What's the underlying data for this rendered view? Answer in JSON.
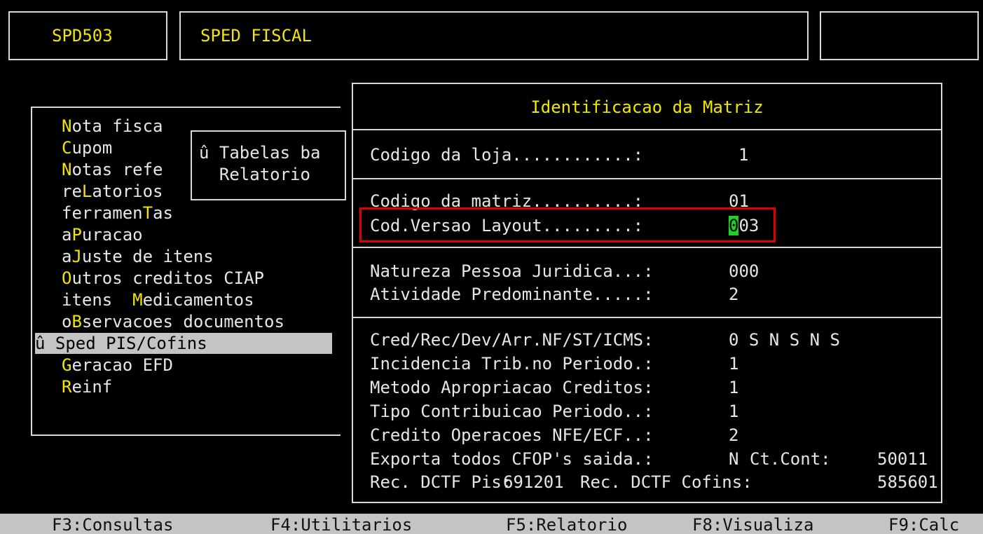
{
  "header": {
    "program_code": "SPD503",
    "title": "SPED FISCAL",
    "right_box": ""
  },
  "main_menu": {
    "items": [
      {
        "key": "N",
        "rest": "ota fisca"
      },
      {
        "key": "C",
        "rest": "upom"
      },
      {
        "key": "N",
        "rest": "otas refe"
      },
      {
        "pre": "re",
        "key": "L",
        "rest": "atorios"
      },
      {
        "pre": "ferramen",
        "key": "T",
        "rest": "as"
      },
      {
        "pre": "a",
        "key": "P",
        "rest": "uracao"
      },
      {
        "pre": "a",
        "key": "J",
        "rest": "uste de itens"
      },
      {
        "key": "O",
        "rest": "utros creditos CIAP"
      },
      {
        "pre": "itens  ",
        "key": "M",
        "rest": "edicamentos"
      },
      {
        "pre": "o",
        "key": "B",
        "rest": "servacoes documentos"
      },
      {
        "selected_label": "û Sped PIS/Cofins"
      },
      {
        "key": "G",
        "rest": "eracao EFD"
      },
      {
        "key": "R",
        "rest": "einf"
      }
    ]
  },
  "submenu": {
    "items": [
      "û Tabelas ba",
      "  Relatorio"
    ]
  },
  "panel": {
    "title": "Identificacao da Matriz",
    "codigo_loja_label": "Codigo da loja............:",
    "codigo_loja_value": "1",
    "codigo_matriz_label": "Codigo da matriz..........:",
    "codigo_matriz_value": "01",
    "versao_label": "Cod.Versao Layout.........:",
    "versao_cursor_char": "0",
    "versao_rest": "03",
    "natureza_label": "Natureza Pessoa Juridica...:",
    "natureza_value": "000",
    "atividade_label": "Atividade Predominante.....:",
    "atividade_value": "2",
    "cred_label": "Cred/Rec/Dev/Arr.NF/ST/ICMS:",
    "cred_value": "0 S N S N S",
    "incidencia_label": "Incidencia Trib.no Periodo.:",
    "incidencia_value": "1",
    "metodo_label": "Metodo Apropriacao Creditos:",
    "metodo_value": "1",
    "tipo_label": "Tipo Contribuicao Periodo..:",
    "tipo_value": "1",
    "credito_label": "Credito Operacoes NFE/ECF..:",
    "credito_value": "2",
    "exporta_label": "Exporta todos CFOP's saida.:",
    "exporta_value": "N",
    "ctcont_label": "Ct.Cont:",
    "ctcont_value": "50011",
    "dctf_pis_label": "Rec. DCTF Pis:",
    "dctf_pis_value": "691201",
    "dctf_cofins_label": "Rec. DCTF Cofins:",
    "dctf_cofins_value": "585601"
  },
  "footer": {
    "f3": "F3:Consultas",
    "f4": "F4:Utilitarios",
    "f5": "F5:Relatorio",
    "f8": "F8:Visualiza",
    "f9": "F9:Calc"
  },
  "colors": {
    "background": "#000000",
    "text": "#e6e6e6",
    "hotkey": "#f2e600",
    "cursor": "#1bd12a",
    "highlight_frame": "#e00000",
    "footer_bg": "#c4c4c4"
  }
}
